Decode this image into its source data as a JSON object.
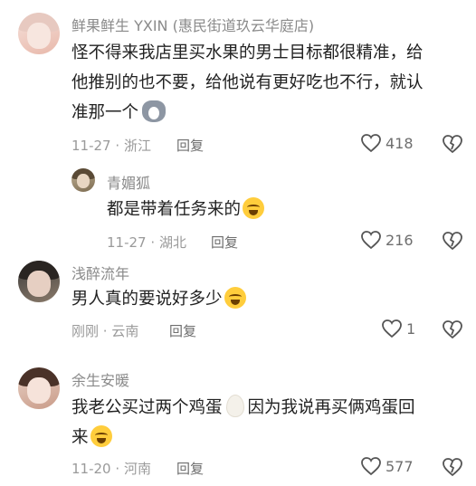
{
  "comments": [
    {
      "username": "鲜果鲜生 YXIN (惠民街道玖云华庭店)",
      "text_lines": [
        "怪不得来我店里买水果的男士目标都很精准，给",
        "他推别的也不要，给他说有更好吃也不行，就认",
        "准那一个"
      ],
      "date": "11-27",
      "location": "浙江",
      "reply_label": "回复",
      "likes": "418"
    },
    {
      "username": "青媚狐",
      "text_lines": [
        "都是带着任务来的"
      ],
      "date": "11-27",
      "location": "湖北",
      "reply_label": "回复",
      "likes": "216"
    },
    {
      "username": "浅醉流年",
      "text_lines": [
        "男人真的要说好多少"
      ],
      "date": "刚刚",
      "location": "云南",
      "reply_label": "回复",
      "likes": "1"
    },
    {
      "username": "余生安暖",
      "text_lines": [
        "我老公买过两个鸡蛋",
        "因为我说再买俩鸡蛋回",
        "来"
      ],
      "date": "11-20",
      "location": "河南",
      "reply_label": "回复",
      "likes": "577"
    }
  ],
  "separator": "·",
  "icons": {
    "like": "heart-outline-icon",
    "dislike": "broken-heart-icon"
  }
}
